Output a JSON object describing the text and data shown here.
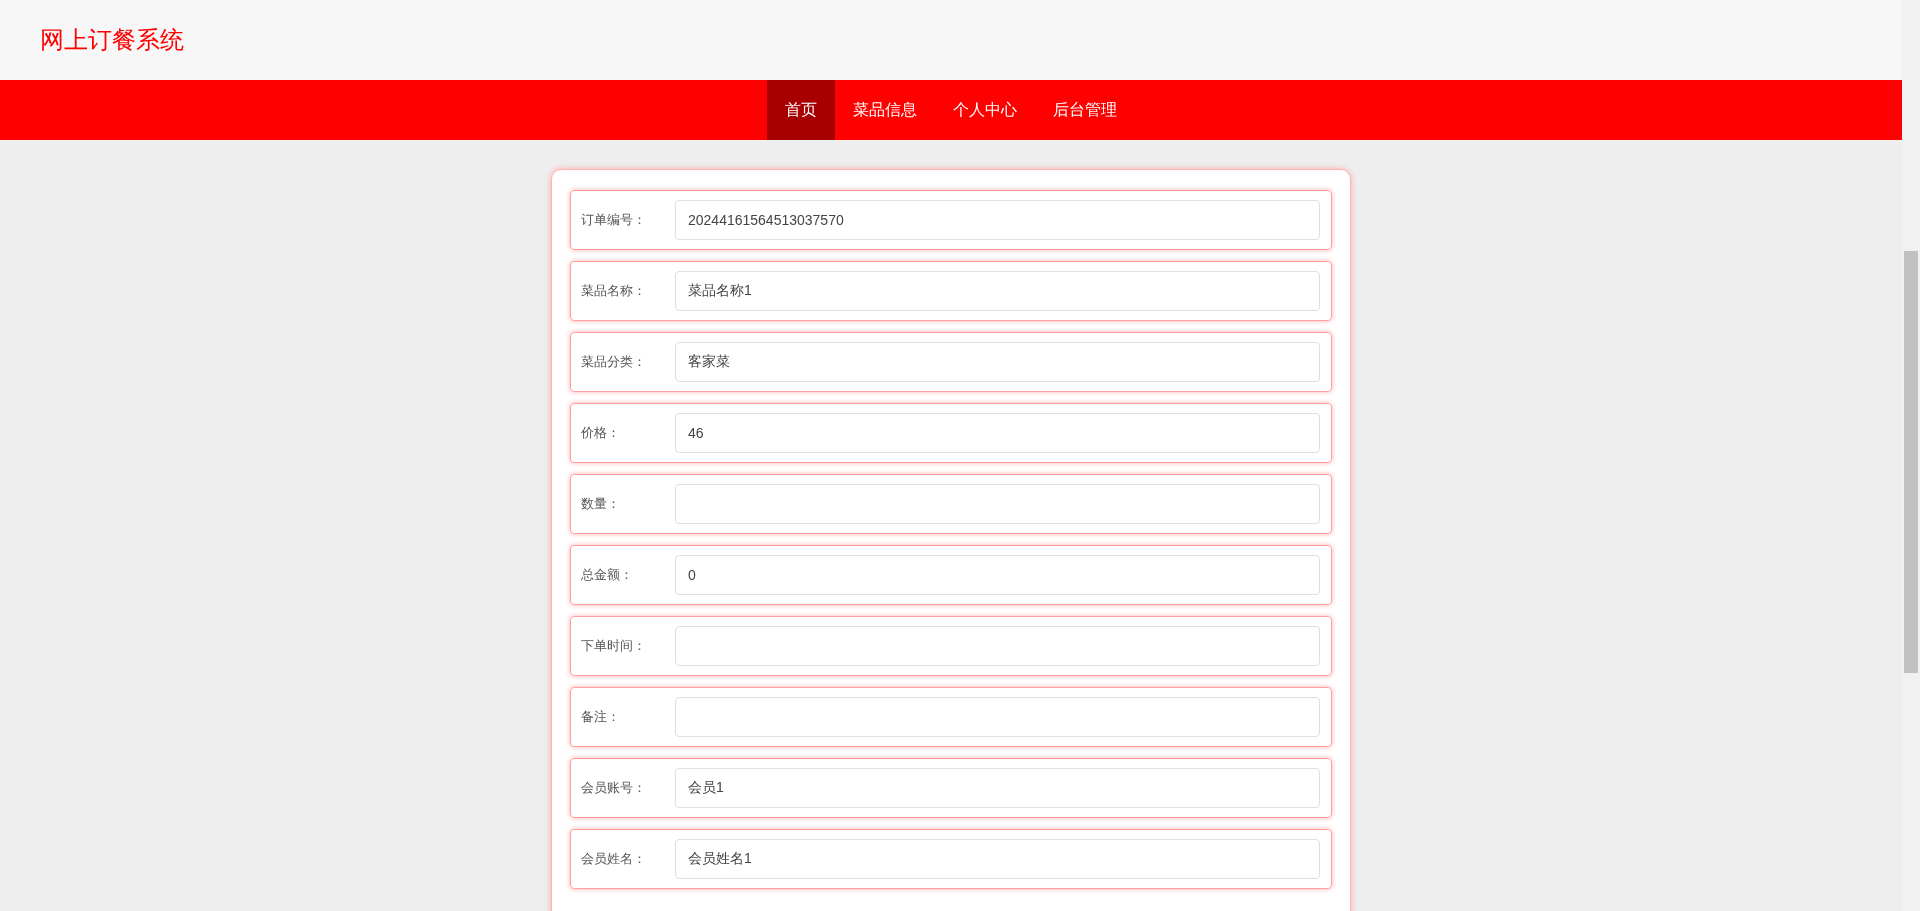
{
  "site_title": "网上订餐系统",
  "nav": [
    {
      "label": "首页",
      "selected": true
    },
    {
      "label": "菜品信息",
      "selected": false
    },
    {
      "label": "个人中心",
      "selected": false
    },
    {
      "label": "后台管理",
      "selected": false
    }
  ],
  "form": {
    "fields": [
      {
        "label": "订单编号：",
        "value": "20244161564513037570"
      },
      {
        "label": "菜品名称：",
        "value": "菜品名称1"
      },
      {
        "label": "菜品分类：",
        "value": "客家菜"
      },
      {
        "label": "价格：",
        "value": "46"
      },
      {
        "label": "数量："
      },
      {
        "label": "总金额：",
        "value": "0"
      },
      {
        "label": "下单时间："
      },
      {
        "label": "备注："
      },
      {
        "label": "会员账号：",
        "value": "会员1"
      },
      {
        "label": "会员姓名：",
        "value": "会员姓名1"
      }
    ]
  }
}
